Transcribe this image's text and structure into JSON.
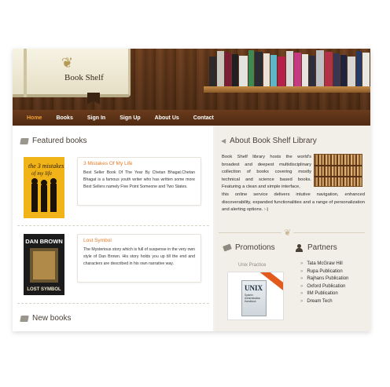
{
  "header": {
    "logo_title": "Book Shelf",
    "ornament": "❦",
    "spine_colors": [
      "#2d2a2c",
      "#c9c7bf",
      "#7a1d35",
      "#1f1f24",
      "#e3e3e0",
      "#3c8a52",
      "#2b2b33",
      "#e9e4d8",
      "#5db7c9",
      "#b6214b",
      "#d9d9d9",
      "#c63a84",
      "#e8e4df",
      "#2a2e3e",
      "#c0bfc3",
      "#b33147",
      "#3a3650",
      "#1e2440",
      "#d8d6d2",
      "#253a66",
      "#e9e7e2"
    ]
  },
  "nav": {
    "items": [
      "Home",
      "Books",
      "Sign In",
      "Sign Up",
      "About Us",
      "Contact"
    ],
    "active": "Home"
  },
  "featured": {
    "heading": "Featured books",
    "books": [
      {
        "title": "3 Mistakes Of My Life",
        "description": "Best Seller Book Of The Year By Chetan Bhagat.Chetan Bhagat is a famous youth writer who has written some more Best Sellers namely Five Point Someone and Two States.",
        "cover_text": [
          "the 3 mistakes",
          "of my life"
        ],
        "cover_color": "#f0b419"
      },
      {
        "title": "Lost Symbol",
        "description": "The Mysterious story which is full of suspense in the very own style of Dan Brown. His story holds you up till the end and characters are described in his own narrative way.",
        "cover_text": [
          "DAN BROWN",
          "LOST SYMBOL"
        ],
        "cover_color": "#1b1b1b"
      }
    ]
  },
  "new_books": {
    "heading": "New books"
  },
  "about": {
    "heading": "About Book Shelf Library",
    "text_part1": "Book Shelf library hosts the world's broadest and deepest multidisciplinary collection of books covering mostly technical and science based books. Featuring a clean and simple interface,",
    "text_part2": "this online service delivers intutive navigation, enhanced discoverability, expanded functionalities and a range of personalization and alerting options. :-)"
  },
  "promotions": {
    "heading": "Promotions",
    "caption": "Unix Practice",
    "book_title": "UNIX",
    "book_subtitle": "System Administration Handbook"
  },
  "partners": {
    "heading": "Partners",
    "items": [
      "Tata McGraw Hill",
      "Rupa Publication",
      "Rajhans Publication",
      "Oxford Publication",
      "IIM Publication",
      "Dream Tech"
    ]
  }
}
